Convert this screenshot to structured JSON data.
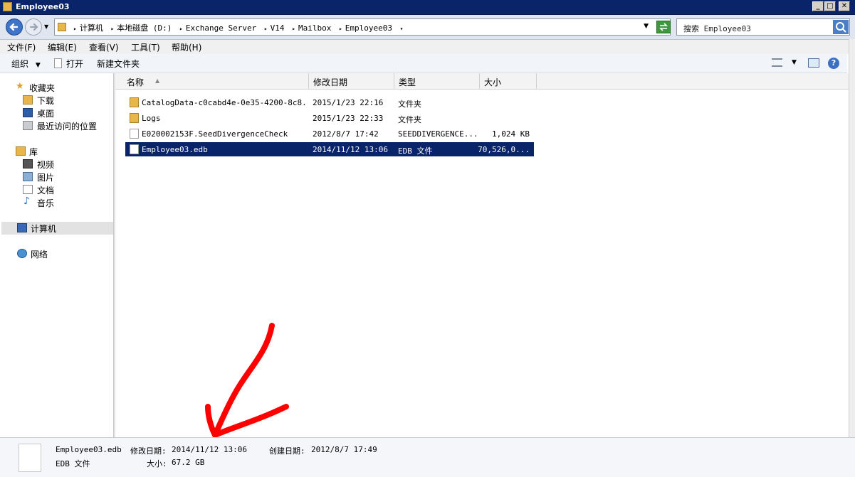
{
  "window": {
    "title": "Employee03"
  },
  "address": {
    "crumbs": [
      "计算机",
      "本地磁盘 (D:)",
      "Exchange Server",
      "V14",
      "Mailbox",
      "Employee03"
    ]
  },
  "search": {
    "placeholder": "搜索 Employee03"
  },
  "menu": [
    "文件(F)",
    "编辑(E)",
    "查看(V)",
    "工具(T)",
    "帮助(H)"
  ],
  "toolbar": {
    "organize": "组织",
    "open": "打开",
    "new_folder": "新建文件夹"
  },
  "sidebar": {
    "favorites": "收藏夹",
    "favorites_items": [
      "下载",
      "桌面",
      "最近访问的位置"
    ],
    "libraries": "库",
    "library_items": [
      "视频",
      "图片",
      "文档",
      "音乐"
    ],
    "computer": "计算机",
    "network": "网络"
  },
  "columns": {
    "name": "名称",
    "date": "修改日期",
    "type": "类型",
    "size": "大小"
  },
  "files": [
    {
      "name": "CatalogData-c0cabd4e-0e35-4200-8c8...",
      "date": "2015/1/23 22:16",
      "type": "文件夹",
      "size": "",
      "icon": "folder-icon"
    },
    {
      "name": "Logs",
      "date": "2015/1/23 22:33",
      "type": "文件夹",
      "size": "",
      "icon": "folder-icon"
    },
    {
      "name": "E020002153F.SeedDivergenceCheck",
      "date": "2012/8/7 17:42",
      "type": "SEEDDIVERGENCE...",
      "size": "1,024 KB",
      "icon": "file-icon"
    },
    {
      "name": "Employee03.edb",
      "date": "2014/11/12 13:06",
      "type": "EDB 文件",
      "size": "70,526,0...",
      "icon": "file-icon",
      "selected": true
    }
  ],
  "details": {
    "filename": "Employee03.edb",
    "modified_label": "修改日期:",
    "modified_value": "2014/11/12 13:06",
    "created_label": "创建日期:",
    "created_value": "2012/8/7 17:49",
    "type": "EDB 文件",
    "size_label": "大小:",
    "size_value": "67.2 GB"
  },
  "colors": {
    "selection": "#0a246a",
    "titlebar": "#0a246a",
    "arrow": "#ff0000",
    "folder": "#e8b64a"
  }
}
